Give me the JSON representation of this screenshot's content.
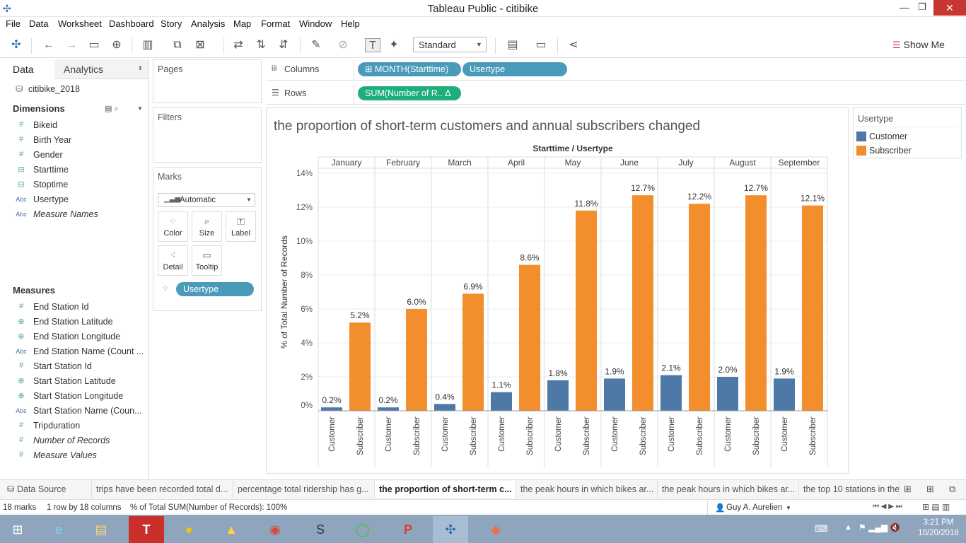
{
  "window": {
    "title": "Tableau Public - citibike"
  },
  "menu": [
    "File",
    "Data",
    "Worksheet",
    "Dashboard",
    "Story",
    "Analysis",
    "Map",
    "Format",
    "Window",
    "Help"
  ],
  "toolbar": {
    "fit_select": "Standard",
    "show_me": "Show Me"
  },
  "left": {
    "tab_data": "Data",
    "tab_analytics": "Analytics",
    "datasource": "citibike_2018",
    "dimensions_title": "Dimensions",
    "dimensions": [
      {
        "icon": "#",
        "name": "Bikeid"
      },
      {
        "icon": "#",
        "name": "Birth Year"
      },
      {
        "icon": "#",
        "name": "Gender"
      },
      {
        "icon": "date",
        "name": "Starttime"
      },
      {
        "icon": "date",
        "name": "Stoptime"
      },
      {
        "icon": "Abc",
        "name": "Usertype"
      },
      {
        "icon": "Abc",
        "name": "Measure Names"
      }
    ],
    "measures_title": "Measures",
    "measures": [
      {
        "icon": "#",
        "name": "End Station Id"
      },
      {
        "icon": "globe",
        "name": "End Station Latitude"
      },
      {
        "icon": "globe",
        "name": "End Station Longitude"
      },
      {
        "icon": "Abc",
        "name": "End Station Name (Count ..."
      },
      {
        "icon": "#",
        "name": "Start Station Id"
      },
      {
        "icon": "globe",
        "name": "Start Station Latitude"
      },
      {
        "icon": "globe",
        "name": "Start Station Longitude"
      },
      {
        "icon": "Abc",
        "name": "Start Station Name (Coun..."
      },
      {
        "icon": "#",
        "name": "Tripduration"
      },
      {
        "icon": "#",
        "name": "Number of Records"
      },
      {
        "icon": "#",
        "name": "Measure Values"
      }
    ]
  },
  "cards": {
    "pages": "Pages",
    "filters": "Filters",
    "marks": "Marks",
    "mark_type": "Automatic",
    "color": "Color",
    "size": "Size",
    "label": "Label",
    "detail": "Detail",
    "tooltip": "Tooltip",
    "usertype_pill": "Usertype"
  },
  "shelves": {
    "columns_label": "Columns",
    "rows_label": "Rows",
    "col_pill1": "MONTH(Starttime)",
    "col_pill2": "Usertype",
    "row_pill": "SUM(Number of R..  Δ"
  },
  "legend": {
    "title": "Usertype",
    "items": [
      {
        "name": "Customer",
        "color": "#4e79a7"
      },
      {
        "name": "Subscriber",
        "color": "#f28e2b"
      }
    ]
  },
  "chart_data": {
    "type": "bar",
    "title": "the proportion of short-term customers and annual subscribers changed",
    "header": "Starttime / Usertype",
    "ylabel": "% of Total Number of Records",
    "ylim": [
      0,
      14
    ],
    "yticks": [
      "0%",
      "2%",
      "4%",
      "6%",
      "8%",
      "10%",
      "12%",
      "14%"
    ],
    "months": [
      "January",
      "February",
      "March",
      "April",
      "May",
      "June",
      "July",
      "August",
      "September"
    ],
    "subcategories": [
      "Customer",
      "Subscriber"
    ],
    "series": [
      {
        "name": "Customer",
        "color": "#4e79a7",
        "values": [
          0.2,
          0.2,
          0.4,
          1.1,
          1.8,
          1.9,
          2.1,
          2.0,
          1.9
        ],
        "labels": [
          "0.2%",
          "0.2%",
          "0.4%",
          "1.1%",
          "1.8%",
          "1.9%",
          "2.1%",
          "2.0%",
          "1.9%"
        ]
      },
      {
        "name": "Subscriber",
        "color": "#f28e2b",
        "values": [
          5.2,
          6.0,
          6.9,
          8.6,
          11.8,
          12.7,
          12.2,
          12.7,
          12.1
        ],
        "labels": [
          "5.2%",
          "6.0%",
          "6.9%",
          "8.6%",
          "11.8%",
          "12.7%",
          "12.2%",
          "12.7%",
          "12.1%"
        ]
      }
    ]
  },
  "sheet_tabs": [
    "Data Source",
    "trips have been recorded total d...",
    "percentage  total ridership has g...",
    "the proportion of short-term c...",
    "the peak hours in which bikes ar...",
    "the peak hours in which bikes ar...",
    "the top 10 stations in the"
  ],
  "status": {
    "marks": "18 marks",
    "rows": "1 row by 18 columns",
    "sum": "% of Total SUM(Number of Records): 100%",
    "user": "Guy A. Aurelien"
  },
  "clock": {
    "time": "3:21 PM",
    "date": "10/20/2018"
  }
}
